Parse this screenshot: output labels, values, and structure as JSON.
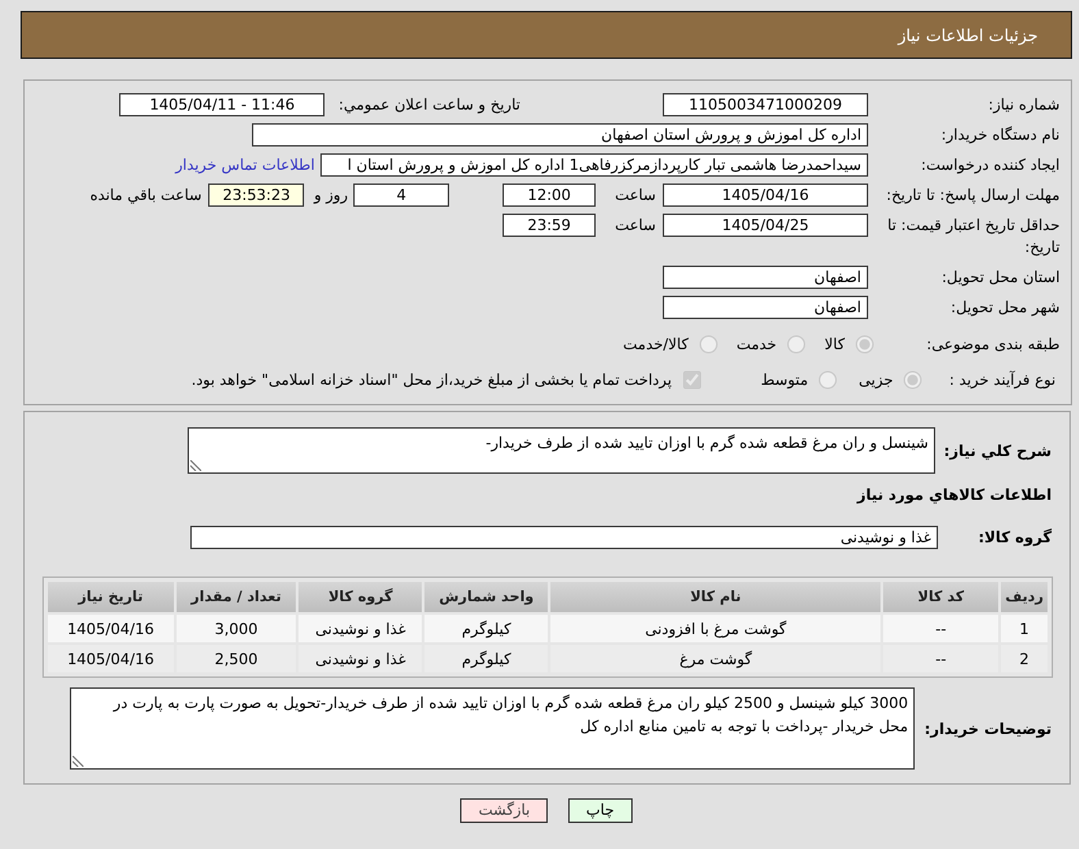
{
  "header": {
    "title": "جزئیات اطلاعات نیاز"
  },
  "info": {
    "need_number": {
      "label": "شماره نیاز:",
      "value": "1105003471000209"
    },
    "announcement": {
      "label": "تاریخ و ساعت اعلان عمومي:",
      "value": "1405/04/11 - 11:46"
    },
    "buyer_org": {
      "label": "نام دستگاه خریدار:",
      "value": "اداره کل اموزش و پرورش استان اصفهان"
    },
    "requester": {
      "label": "ایجاد کننده درخواست:",
      "value": "سیداحمدرضا هاشمی تبار کارپردازمرکزرفاهی1 اداره کل اموزش و پرورش استان ا",
      "link": "اطلاعات تماس خریدار"
    },
    "reply_deadline": {
      "label": "مهلت ارسال پاسخ: تا تاریخ:",
      "date": "1405/04/16",
      "time_label": "ساعت",
      "time": "12:00",
      "days": "4",
      "days_label": "روز و",
      "remaining": "23:53:23",
      "remaining_label": "ساعت باقي مانده"
    },
    "price_validity": {
      "label": "حداقل تاریخ اعتبار قیمت: تا تاریخ:",
      "date": "1405/04/25",
      "time_label": "ساعت",
      "time": "23:59"
    },
    "delivery_province": {
      "label": "استان محل تحویل:",
      "value": "اصفهان"
    },
    "delivery_city": {
      "label": "شهر محل تحویل:",
      "value": "اصفهان"
    },
    "subject_category": {
      "label": "طبقه بندی موضوعی:",
      "options": [
        {
          "label": "کالا",
          "selected": true,
          "disabled": true
        },
        {
          "label": "خدمت",
          "selected": false,
          "disabled": true
        },
        {
          "label": "کالا/خدمت",
          "selected": false,
          "disabled": true
        }
      ]
    },
    "purchase_process": {
      "label": "نوع فرآیند خرید :",
      "options": [
        {
          "label": "جزیی",
          "selected": true,
          "disabled": true
        },
        {
          "label": "متوسط",
          "selected": false,
          "disabled": true
        }
      ],
      "treasury_payment": {
        "label": "پرداخت تمام یا بخشی از مبلغ خرید،از محل \"اسناد خزانه اسلامی\" خواهد بود.",
        "checked": true,
        "disabled": true
      }
    }
  },
  "items": {
    "description": {
      "label": "شرح کلي نياز:",
      "value": "شینسل و ران مرغ قطعه شده گرم با اوزان تایید شده از طرف خریدار-"
    },
    "section_title": "اطلاعات کالاهاي مورد نياز",
    "goods_group": {
      "label": "گروه کالا:",
      "value": "غذا و نوشیدنی"
    },
    "table": {
      "columns": [
        "ردیف",
        "کد کالا",
        "نام کالا",
        "واحد شمارش",
        "گروه کالا",
        "تعداد / مقدار",
        "تاریخ نیاز"
      ],
      "rows": [
        [
          "1",
          "--",
          "گوشت مرغ با افزودنی",
          "کیلوگرم",
          "غذا و نوشیدنی",
          "3,000",
          "1405/04/16"
        ],
        [
          "2",
          "--",
          "گوشت مرغ",
          "کیلوگرم",
          "غذا و نوشیدنی",
          "2,500",
          "1405/04/16"
        ]
      ]
    },
    "buyer_notes": {
      "label": "توضیحات خریدار:",
      "value": "3000 کیلو شینسل و 2500 کیلو ران مرغ قطعه شده گرم با اوزان تایید شده از طرف خریدار-تحویل به صورت پارت به پارت در محل خریدار -پرداخت با توجه به تامین منابع اداره کل"
    }
  },
  "buttons": [
    {
      "label": "چاپ",
      "kind": "print"
    },
    {
      "label": "بازگشت",
      "kind": "back"
    }
  ]
}
